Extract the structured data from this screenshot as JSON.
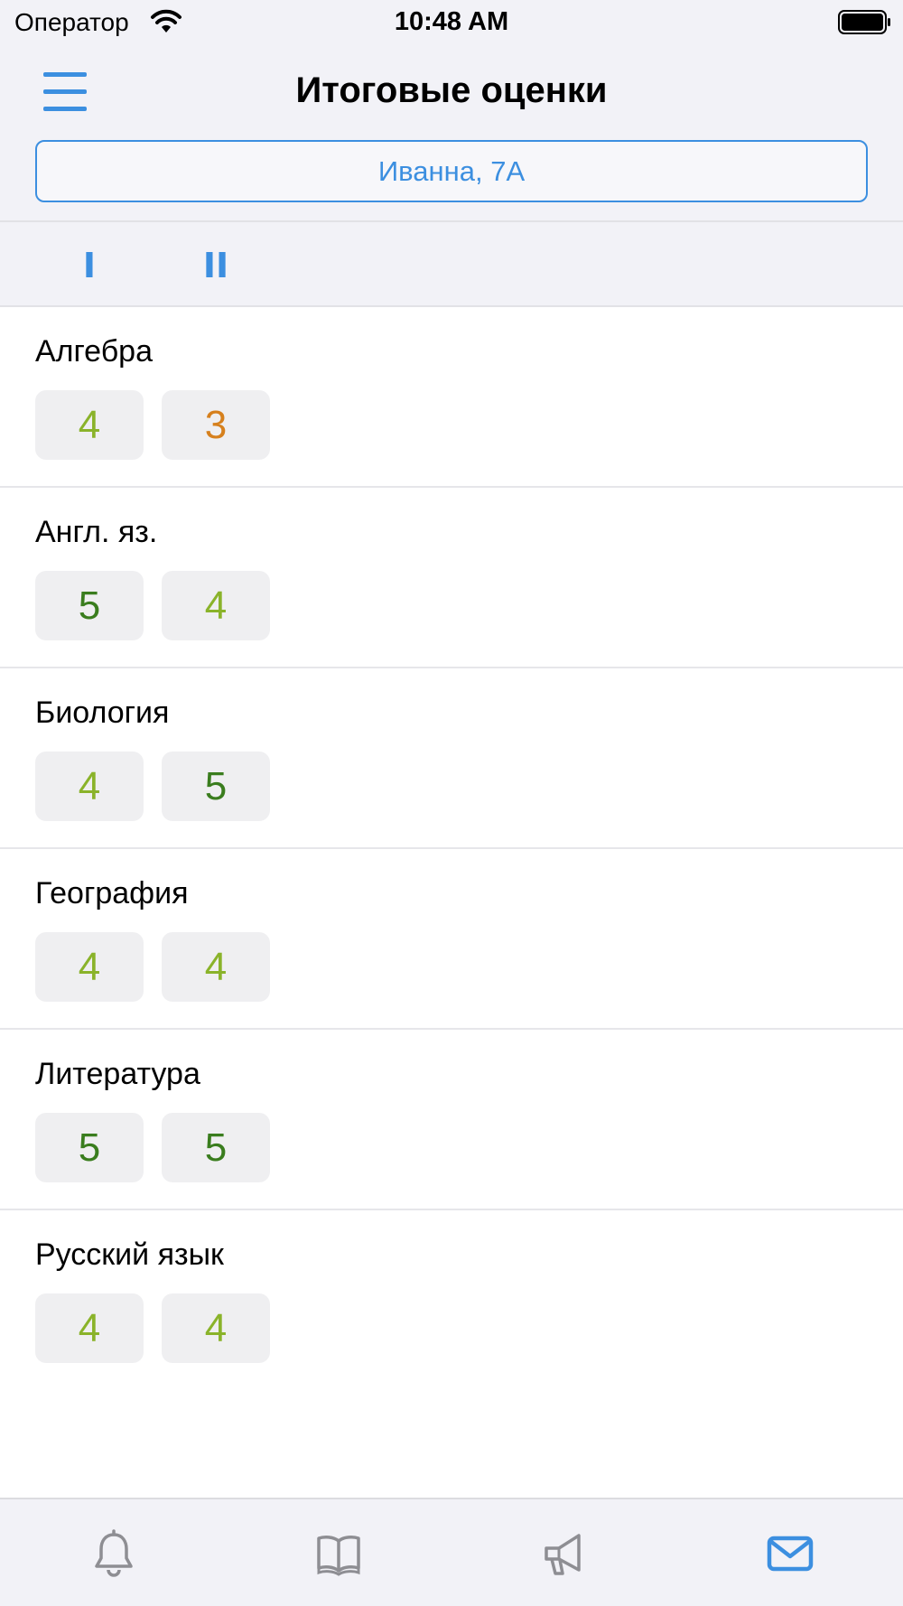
{
  "status_bar": {
    "carrier": "Оператор",
    "time": "10:48 AM"
  },
  "header": {
    "title": "Итоговые оценки",
    "student": "Иванна, 7А"
  },
  "terms": [
    {
      "label": "I"
    },
    {
      "label": "II"
    }
  ],
  "grade_colors": {
    "5": "#3a7d1e",
    "4": "#8ab32a",
    "3": "#d6801d"
  },
  "subjects": [
    {
      "name": "Алгебра",
      "grades": [
        "4",
        "3"
      ]
    },
    {
      "name": "Англ. яз.",
      "grades": [
        "5",
        "4"
      ]
    },
    {
      "name": "Биология",
      "grades": [
        "4",
        "5"
      ]
    },
    {
      "name": "География",
      "grades": [
        "4",
        "4"
      ]
    },
    {
      "name": "Литература",
      "grades": [
        "5",
        "5"
      ]
    },
    {
      "name": "Русский язык",
      "grades": [
        "4",
        "4"
      ]
    }
  ],
  "tabbar": {
    "items": [
      {
        "icon": "bell-icon",
        "active": false
      },
      {
        "icon": "book-icon",
        "active": false
      },
      {
        "icon": "megaphone-icon",
        "active": false
      },
      {
        "icon": "envelope-icon",
        "active": true
      }
    ],
    "active_color": "#3c8fe0",
    "inactive_color": "#8e8e93"
  }
}
